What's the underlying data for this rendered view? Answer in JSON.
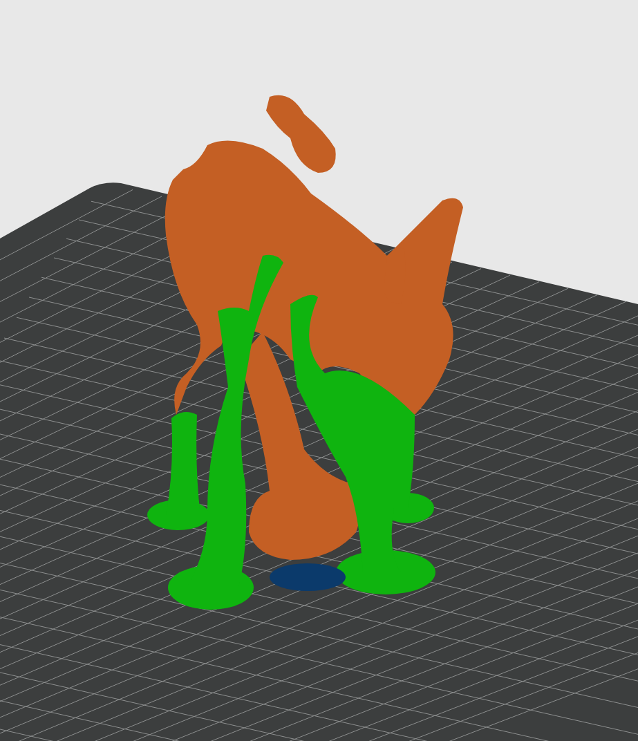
{
  "build_plate": {
    "grid_visible": true
  }
}
